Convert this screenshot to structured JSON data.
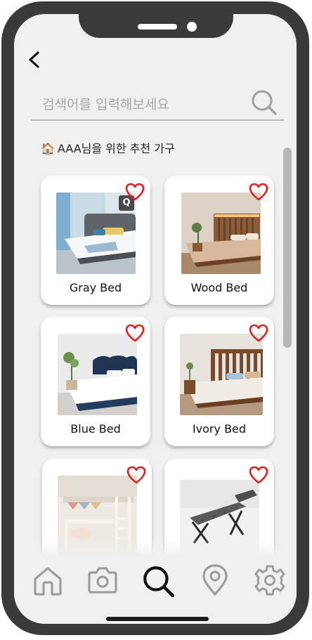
{
  "search": {
    "placeholder": "검색어를 입력해보세요"
  },
  "section": {
    "icon": "🏠",
    "title": "AAA님을 위한 추천 가구"
  },
  "products": [
    {
      "name": "Gray Bed",
      "favorite": false,
      "badge": "Q"
    },
    {
      "name": "Wood Bed",
      "favorite": false,
      "badge": ""
    },
    {
      "name": "Blue Bed",
      "favorite": false,
      "badge": ""
    },
    {
      "name": "Ivory Bed",
      "favorite": false,
      "badge": ""
    },
    {
      "name": "",
      "favorite": false,
      "badge": ""
    },
    {
      "name": "",
      "favorite": false,
      "badge": ""
    }
  ],
  "tabs": [
    {
      "icon": "home-icon",
      "active": false
    },
    {
      "icon": "camera-icon",
      "active": false
    },
    {
      "icon": "search-icon",
      "active": true
    },
    {
      "icon": "location-pin-icon",
      "active": false
    },
    {
      "icon": "gear-icon",
      "active": false
    }
  ],
  "colors": {
    "heart": "#e0201e",
    "active_tab": "#111111",
    "inactive_tab": "#9d9d9d",
    "frame": "#3a3a3a",
    "screen_bg": "#f0f0f0"
  }
}
